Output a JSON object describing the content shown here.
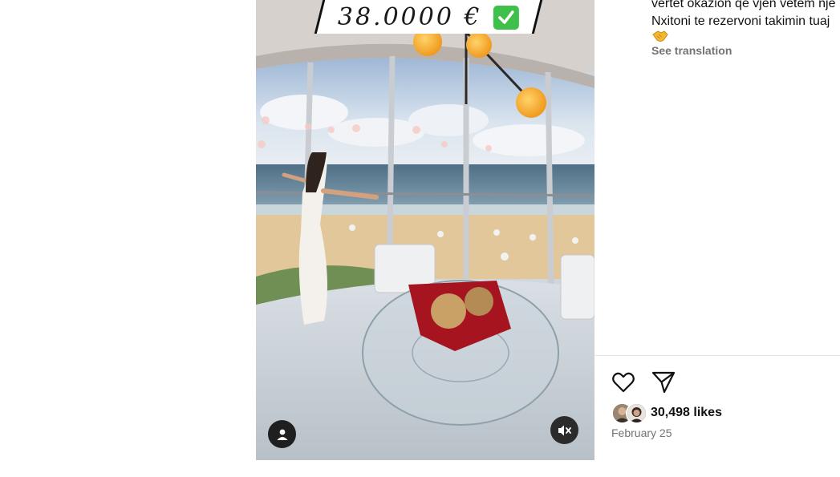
{
  "post": {
    "price_banner": "38.0000 €",
    "caption_line_1": "vertet okazion që vjen vetëm një",
    "caption_line_2": "Nxitoni te rezervoni takimin tuaj",
    "see_translation": "See translation",
    "likes": "30,498 likes",
    "date": "February 25"
  },
  "icons": {
    "check": "check-mark-icon",
    "profile": "user-icon",
    "mute": "muted-speaker-icon",
    "heart": "heart-icon",
    "share": "paper-plane-icon",
    "emoji": "handshake-emoji"
  },
  "colors": {
    "secondary_text": "#737373",
    "check_green": "#3ec04a",
    "divider": "#e3e3e3"
  }
}
